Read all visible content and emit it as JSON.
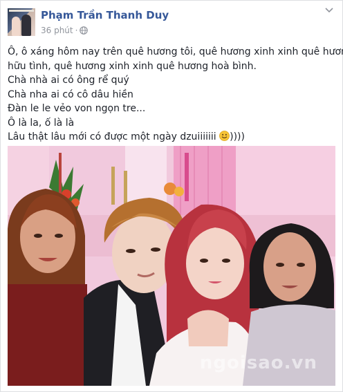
{
  "post": {
    "author": "Phạm Trần Thanh Duy",
    "time": "36 phút",
    "separator": "·",
    "privacy_icon": "globe-icon",
    "lines": [
      "Ô, ô xáng hôm nay trên quê hương tôi, quê hương xinh xinh quê hương",
      "hữu tình, quê hương xinh xinh quê hương hoà bình.",
      "Chà nhà ai có ông rể quý",
      "Chà nha ai có cô dâu hiền",
      "Đàn le le vẻo von ngọn tre...",
      "Ô là la, ố là là",
      "Lâu thật lâu mới có được một ngày dzuiiiiiii"
    ],
    "last_line_tail": "))))",
    "emoji": "smiley-icon"
  },
  "photo": {
    "watermark": "ngoisao.vn"
  },
  "colors": {
    "author_link": "#365899",
    "meta_text": "#90949c",
    "body_text": "#1d2129",
    "card_border": "#dddfe2"
  }
}
